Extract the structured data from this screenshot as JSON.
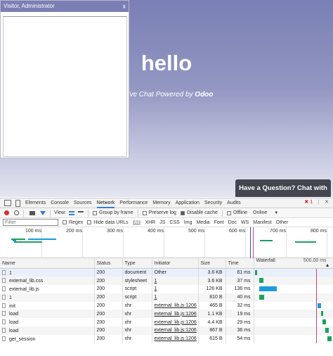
{
  "chat_window": {
    "title": "Visitor, Administrator",
    "close_glyph": "x"
  },
  "hero": {
    "title": "hello",
    "subtitle_prefix": "ate Live Chat Powered by ",
    "subtitle_brand": "Odoo"
  },
  "chat_button": {
    "label": "Have a Question? Chat with us."
  },
  "devtools": {
    "tabs": [
      "Elements",
      "Console",
      "Sources",
      "Network",
      "Performance",
      "Memory",
      "Application",
      "Security",
      "Audits"
    ],
    "active_tab": "Network",
    "error_count": "1",
    "toolbar": {
      "view_label": "View:",
      "group_by_frame": "Group by frame",
      "preserve_log": "Preserve log",
      "disable_cache": "Disable cache",
      "offline": "Offline",
      "online": "Online"
    },
    "filter": {
      "placeholder": "Filter",
      "regex": "Regex",
      "hide_data_urls": "Hide data URLs",
      "types": [
        "All",
        "XHR",
        "JS",
        "CSS",
        "Img",
        "Media",
        "Font",
        "Doc",
        "WS",
        "Manifest",
        "Other"
      ]
    },
    "overview_ticks": [
      "100 ms",
      "200 ms",
      "300 ms",
      "400 ms",
      "500 ms",
      "600 ms",
      "700 ms",
      "800 ms"
    ],
    "columns": {
      "name": "Name",
      "status": "Status",
      "type": "Type",
      "initiator": "Initiator",
      "size": "Size",
      "time": "Time",
      "waterfall": "Waterfall",
      "waterfall_time": "500.00 ms"
    },
    "requests": [
      {
        "name": "1",
        "status": "200",
        "type": "document",
        "initiator": "Other",
        "size": "3.6 KB",
        "time": "61 ms",
        "wf_start": 0.0,
        "wf_len": 0.03,
        "wf_color": "#1aa260"
      },
      {
        "name": "external_lib.css",
        "status": "200",
        "type": "stylesheet",
        "initiator": "1",
        "size": "3.6 KB",
        "time": "37 ms",
        "wf_start": 0.06,
        "wf_len": 0.05,
        "wf_color": "#1aa260"
      },
      {
        "name": "external_lib.js",
        "status": "200",
        "type": "script",
        "initiator": "1",
        "size": "126 KB",
        "time": "136 ms",
        "wf_start": 0.06,
        "wf_len": 0.23,
        "wf_color": "#1a9be0"
      },
      {
        "name": "1",
        "status": "200",
        "type": "script",
        "initiator": "1",
        "size": "810 B",
        "time": "40 ms",
        "wf_start": 0.06,
        "wf_len": 0.06,
        "wf_color": "#1aa260"
      },
      {
        "name": "init",
        "status": "200",
        "type": "xhr",
        "initiator": "external_lib.js:1206",
        "size": "465 B",
        "time": "32 ms",
        "wf_start": 0.81,
        "wf_len": 0.05,
        "wf_color": "#1a9be0"
      },
      {
        "name": "load",
        "status": "200",
        "type": "xhr",
        "initiator": "external_lib.js:1206",
        "size": "1.1 KB",
        "time": "19 ms",
        "wf_start": 0.86,
        "wf_len": 0.03,
        "wf_color": "#1aa260"
      },
      {
        "name": "load",
        "status": "200",
        "type": "xhr",
        "initiator": "external_lib.js:1206",
        "size": "4.4 KB",
        "time": "29 ms",
        "wf_start": 0.88,
        "wf_len": 0.04,
        "wf_color": "#1aa260"
      },
      {
        "name": "load",
        "status": "200",
        "type": "xhr",
        "initiator": "external_lib.js:1206",
        "size": "867 B",
        "time": "36 ms",
        "wf_start": 0.91,
        "wf_len": 0.05,
        "wf_color": "#1aa260"
      },
      {
        "name": "get_session",
        "status": "200",
        "type": "xhr",
        "initiator": "external_lib.js:1206",
        "size": "615 B",
        "time": "54 ms",
        "wf_start": 0.94,
        "wf_len": 0.06,
        "wf_color": "#1aa260"
      }
    ]
  }
}
